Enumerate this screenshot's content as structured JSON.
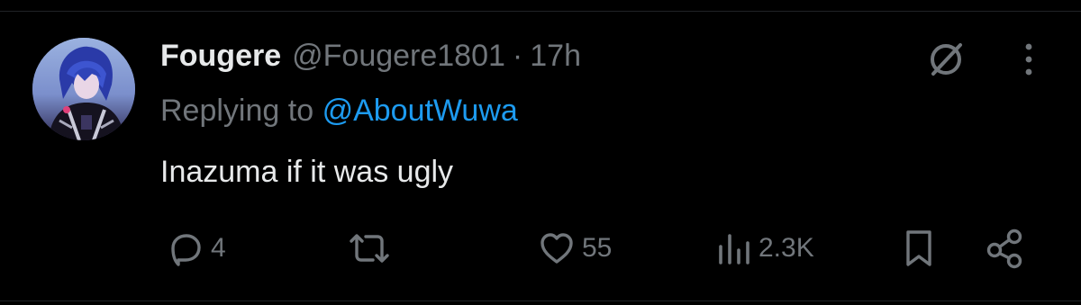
{
  "tweet": {
    "display_name": "Fougere",
    "handle": "@Fougere1801",
    "separator": "·",
    "time": "17h",
    "replying_prefix": "Replying to",
    "replying_to": "@AboutWuwa",
    "text": "Inazuma if it was ugly"
  },
  "actions": {
    "replies": "4",
    "likes": "55",
    "views": "2.3K"
  },
  "icons": {
    "grok": "grok-icon",
    "more": "more-icon",
    "reply": "reply-icon",
    "repost": "repost-icon",
    "like": "heart-icon",
    "views": "views-icon",
    "bookmark": "bookmark-icon",
    "share": "share-icon"
  },
  "colors": {
    "background": "#000000",
    "text": "#e7e9ea",
    "muted": "#71767b",
    "link": "#1d9bf0"
  }
}
